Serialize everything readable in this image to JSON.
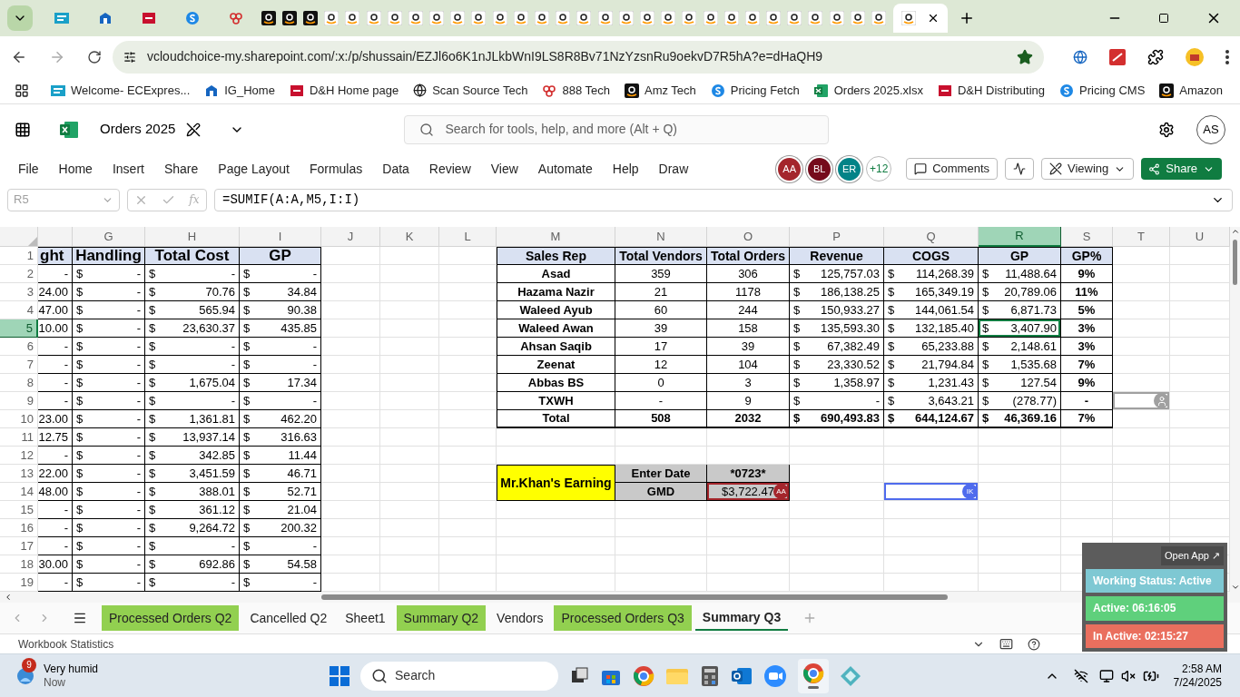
{
  "browser": {
    "tabs": [
      {
        "kind": "ec",
        "selected": false
      },
      {
        "kind": "ig",
        "selected": false
      },
      {
        "kind": "dh",
        "selected": false
      },
      {
        "kind": "s",
        "selected": false
      },
      {
        "kind": "rings",
        "selected": false
      },
      {
        "kind": "amazon_dark",
        "selected": false
      },
      {
        "kind": "amazon_dark",
        "selected": false
      },
      {
        "kind": "amazon_dark",
        "selected": false
      },
      {
        "kind": "amazon",
        "selected": false
      },
      {
        "kind": "amazon",
        "selected": false
      },
      {
        "kind": "amazon",
        "selected": false
      },
      {
        "kind": "amazon",
        "selected": false
      },
      {
        "kind": "amazon",
        "selected": false
      },
      {
        "kind": "amazon",
        "selected": false
      },
      {
        "kind": "amazon",
        "selected": false
      },
      {
        "kind": "amazon",
        "selected": false
      },
      {
        "kind": "amazon",
        "selected": false
      },
      {
        "kind": "amazon",
        "selected": false
      },
      {
        "kind": "amazon",
        "selected": false
      },
      {
        "kind": "amazon",
        "selected": false
      },
      {
        "kind": "amazon",
        "selected": false
      },
      {
        "kind": "amazon",
        "selected": false
      },
      {
        "kind": "amazon",
        "selected": false
      },
      {
        "kind": "amazon",
        "selected": false
      },
      {
        "kind": "amazon",
        "selected": false
      },
      {
        "kind": "amazon",
        "selected": false
      },
      {
        "kind": "amazon",
        "selected": false
      },
      {
        "kind": "amazon",
        "selected": false
      },
      {
        "kind": "amazon",
        "selected": false
      },
      {
        "kind": "amazon",
        "selected": false
      },
      {
        "kind": "amazon",
        "selected": false
      },
      {
        "kind": "amazon",
        "selected": false
      },
      {
        "kind": "amazon",
        "selected": false
      },
      {
        "kind": "amazon",
        "selected": false
      },
      {
        "kind": "amazon",
        "selected": false
      },
      {
        "kind": "amazon",
        "selected": true
      }
    ],
    "url": "vcloudchoice-my.sharepoint.com/:x:/p/shussain/EZJl6o6K1nJLkbWnI9LS8R8Bv71NzYzsnRu9oekvD7R5hA?e=dHaQH9",
    "bookmarks": [
      {
        "kind": "ec",
        "label": "Welcome- ECExpres..."
      },
      {
        "kind": "ig",
        "label": "IG_Home"
      },
      {
        "kind": "dh",
        "label": "D&H Home page"
      },
      {
        "kind": "globe",
        "label": "Scan Source Tech"
      },
      {
        "kind": "rings",
        "label": "888 Tech"
      },
      {
        "kind": "amazon_dark",
        "label": "Amz Tech"
      },
      {
        "kind": "s",
        "label": "Pricing Fetch"
      },
      {
        "kind": "excel",
        "label": "Orders 2025.xlsx"
      },
      {
        "kind": "dh",
        "label": "D&H Distributing"
      },
      {
        "kind": "s",
        "label": "Pricing CMS"
      },
      {
        "kind": "amazon_dark",
        "label": "Amazon"
      }
    ]
  },
  "app": {
    "file_name": "Orders 2025",
    "search_placeholder": "Search for tools, help, and more (Alt + Q)",
    "account_initials": "AS",
    "menu": [
      "File",
      "Home",
      "Insert",
      "Share",
      "Page Layout",
      "Formulas",
      "Data",
      "Review",
      "View",
      "Automate",
      "Help",
      "Draw"
    ],
    "collaborators": [
      {
        "initials": "AA",
        "color": "#a4262c"
      },
      {
        "initials": "BL",
        "color": "#750b1c"
      },
      {
        "initials": "ER",
        "color": "#038387"
      }
    ],
    "more_collaborators": "+12",
    "comments_label": "Comments",
    "mode_label": "Viewing",
    "share_label": "Share"
  },
  "formula_bar": {
    "name_box": "R5",
    "function_button": "fx",
    "formula": "=SUMIF(A:A,M5,I:I)"
  },
  "column_headers": [
    "G",
    "H",
    "I",
    "J",
    "K",
    "L",
    "M",
    "N",
    "O",
    "P",
    "Q",
    "R",
    "S",
    "T",
    "U"
  ],
  "row_numbers": [
    "1",
    "2",
    "3",
    "4",
    "5",
    "6",
    "7",
    "8",
    "9",
    "10",
    "11",
    "12",
    "13",
    "14",
    "15",
    "16",
    "17",
    "18",
    "19"
  ],
  "left_table": {
    "header": [
      "ght",
      "Handling",
      "Total Cost",
      "GP"
    ],
    "rows": [
      {
        "column_f": "-",
        "handling": {
          "symbol": "$",
          "value": "-"
        },
        "total_cost": {
          "symbol": "$",
          "value": "-"
        },
        "gp": {
          "symbol": "$",
          "value": "-"
        }
      },
      {
        "column_f": "24.00",
        "handling": {
          "symbol": "$",
          "value": "-"
        },
        "total_cost": {
          "symbol": "$",
          "value": "70.76"
        },
        "gp": {
          "symbol": "$",
          "value": "34.84"
        }
      },
      {
        "column_f": "47.00",
        "handling": {
          "symbol": "$",
          "value": "-"
        },
        "total_cost": {
          "symbol": "$",
          "value": "565.94"
        },
        "gp": {
          "symbol": "$",
          "value": "90.38"
        }
      },
      {
        "column_f": "10.00",
        "handling": {
          "symbol": "$",
          "value": "-"
        },
        "total_cost": {
          "symbol": "$",
          "value": "23,630.37"
        },
        "gp": {
          "symbol": "$",
          "value": "435.85"
        }
      },
      {
        "column_f": "-",
        "handling": {
          "symbol": "$",
          "value": "-"
        },
        "total_cost": {
          "symbol": "$",
          "value": "-"
        },
        "gp": {
          "symbol": "$",
          "value": "-"
        }
      },
      {
        "column_f": "-",
        "handling": {
          "symbol": "$",
          "value": "-"
        },
        "total_cost": {
          "symbol": "$",
          "value": "-"
        },
        "gp": {
          "symbol": "$",
          "value": "-"
        }
      },
      {
        "column_f": "-",
        "handling": {
          "symbol": "$",
          "value": "-"
        },
        "total_cost": {
          "symbol": "$",
          "value": "1,675.04"
        },
        "gp": {
          "symbol": "$",
          "value": "17.34"
        }
      },
      {
        "column_f": "-",
        "handling": {
          "symbol": "$",
          "value": "-"
        },
        "total_cost": {
          "symbol": "$",
          "value": "-"
        },
        "gp": {
          "symbol": "$",
          "value": "-"
        }
      },
      {
        "column_f": "23.00",
        "handling": {
          "symbol": "$",
          "value": "-"
        },
        "total_cost": {
          "symbol": "$",
          "value": "1,361.81"
        },
        "gp": {
          "symbol": "$",
          "value": "462.20"
        }
      },
      {
        "column_f": "12.75",
        "handling": {
          "symbol": "$",
          "value": "-"
        },
        "total_cost": {
          "symbol": "$",
          "value": "13,937.14"
        },
        "gp": {
          "symbol": "$",
          "value": "316.63"
        }
      },
      {
        "column_f": "-",
        "handling": {
          "symbol": "$",
          "value": "-"
        },
        "total_cost": {
          "symbol": "$",
          "value": "342.85"
        },
        "gp": {
          "symbol": "$",
          "value": "11.44"
        }
      },
      {
        "column_f": "22.00",
        "handling": {
          "symbol": "$",
          "value": "-"
        },
        "total_cost": {
          "symbol": "$",
          "value": "3,451.59"
        },
        "gp": {
          "symbol": "$",
          "value": "46.71"
        }
      },
      {
        "column_f": "48.00",
        "handling": {
          "symbol": "$",
          "value": "-"
        },
        "total_cost": {
          "symbol": "$",
          "value": "388.01"
        },
        "gp": {
          "symbol": "$",
          "value": "52.71"
        }
      },
      {
        "column_f": "-",
        "handling": {
          "symbol": "$",
          "value": "-"
        },
        "total_cost": {
          "symbol": "$",
          "value": "361.12"
        },
        "gp": {
          "symbol": "$",
          "value": "21.04"
        }
      },
      {
        "column_f": "-",
        "handling": {
          "symbol": "$",
          "value": "-"
        },
        "total_cost": {
          "symbol": "$",
          "value": "9,264.72"
        },
        "gp": {
          "symbol": "$",
          "value": "200.32"
        }
      },
      {
        "column_f": "-",
        "handling": {
          "symbol": "$",
          "value": "-"
        },
        "total_cost": {
          "symbol": "$",
          "value": "-"
        },
        "gp": {
          "symbol": "$",
          "value": "-"
        }
      },
      {
        "column_f": "30.00",
        "handling": {
          "symbol": "$",
          "value": "-"
        },
        "total_cost": {
          "symbol": "$",
          "value": "692.86"
        },
        "gp": {
          "symbol": "$",
          "value": "54.58"
        }
      },
      {
        "column_f": "-",
        "handling": {
          "symbol": "$",
          "value": "-"
        },
        "total_cost": {
          "symbol": "$",
          "value": "-"
        },
        "gp": {
          "symbol": "$",
          "value": "-"
        }
      }
    ]
  },
  "right_table": {
    "header": [
      "Sales Rep",
      "Total Vendors",
      "Total Orders",
      "Revenue",
      "COGS",
      "GP",
      "GP%"
    ],
    "rows": [
      {
        "kind": "rep",
        "sales_rep": "Asad",
        "total_vendors": "359",
        "total_orders": "306",
        "revenue": {
          "symbol": "$",
          "value": "125,757.03"
        },
        "cogs": {
          "symbol": "$",
          "value": "114,268.39"
        },
        "gp": {
          "symbol": "$",
          "value": "11,488.64",
          "selected": false
        },
        "gp_pct": "9%"
      },
      {
        "kind": "rep",
        "sales_rep": "Hazama Nazir",
        "total_vendors": "21",
        "total_orders": "1178",
        "revenue": {
          "symbol": "$",
          "value": "186,138.25"
        },
        "cogs": {
          "symbol": "$",
          "value": "165,349.19"
        },
        "gp": {
          "symbol": "$",
          "value": "20,789.06",
          "selected": false
        },
        "gp_pct": "11%"
      },
      {
        "kind": "rep",
        "sales_rep": "Waleed Ayub",
        "total_vendors": "60",
        "total_orders": "244",
        "revenue": {
          "symbol": "$",
          "value": "150,933.27"
        },
        "cogs": {
          "symbol": "$",
          "value": "144,061.54"
        },
        "gp": {
          "symbol": "$",
          "value": "6,871.73",
          "selected": false
        },
        "gp_pct": "5%"
      },
      {
        "kind": "rep",
        "sales_rep": "Waleed Awan",
        "total_vendors": "39",
        "total_orders": "158",
        "revenue": {
          "symbol": "$",
          "value": "135,593.30"
        },
        "cogs": {
          "symbol": "$",
          "value": "132,185.40"
        },
        "gp": {
          "symbol": "$",
          "value": "3,407.90",
          "selected": true
        },
        "gp_pct": "3%"
      },
      {
        "kind": "rep",
        "sales_rep": "Ahsan Saqib",
        "total_vendors": "17",
        "total_orders": "39",
        "revenue": {
          "symbol": "$",
          "value": "67,382.49"
        },
        "cogs": {
          "symbol": "$",
          "value": "65,233.88"
        },
        "gp": {
          "symbol": "$",
          "value": "2,148.61",
          "selected": false
        },
        "gp_pct": "3%"
      },
      {
        "kind": "rep",
        "sales_rep": "Zeenat",
        "total_vendors": "12",
        "total_orders": "104",
        "revenue": {
          "symbol": "$",
          "value": "23,330.52"
        },
        "cogs": {
          "symbol": "$",
          "value": "21,794.84"
        },
        "gp": {
          "symbol": "$",
          "value": "1,535.68",
          "selected": false
        },
        "gp_pct": "7%"
      },
      {
        "kind": "rep",
        "sales_rep": "Abbas BS",
        "total_vendors": "0",
        "total_orders": "3",
        "revenue": {
          "symbol": "$",
          "value": "1,358.97"
        },
        "cogs": {
          "symbol": "$",
          "value": "1,231.43"
        },
        "gp": {
          "symbol": "$",
          "value": "127.54",
          "selected": false
        },
        "gp_pct": "9%"
      },
      {
        "kind": "rep",
        "sales_rep": "TXWH",
        "total_vendors": "-",
        "total_orders": "9",
        "revenue": {
          "symbol": "$",
          "value": "-"
        },
        "cogs": {
          "symbol": "$",
          "value": "3,643.21"
        },
        "gp": {
          "symbol": "$",
          "value": "(278.77)",
          "selected": false
        },
        "gp_pct": "-"
      },
      {
        "kind": "total",
        "sales_rep": "Total",
        "total_vendors": "508",
        "total_orders": "2032",
        "revenue": {
          "symbol": "$",
          "value": "690,493.83"
        },
        "cogs": {
          "symbol": "$",
          "value": "644,124.67"
        },
        "gp": {
          "symbol": "$",
          "value": "46,369.16",
          "selected": false
        },
        "gp_pct": "7%"
      }
    ]
  },
  "earning": {
    "label": "Mr.Khan's Earning",
    "date_label": "Enter Date",
    "date_value": "*0723*",
    "gmd_label": "GMD",
    "gmd_value": "$3,722.47"
  },
  "presence": [
    {
      "kind": "user",
      "initials": "AA",
      "color": "#a4262c"
    },
    {
      "kind": "user",
      "initials": "IK",
      "color": "#4f6bed"
    },
    {
      "kind": "anonymous",
      "color": "#a0a0a0"
    }
  ],
  "sheet_tabs": [
    {
      "label": "Processed Orders Q2",
      "color": "#92d050",
      "selected": false
    },
    {
      "label": "Cancelled Q2",
      "selected": false
    },
    {
      "label": "Sheet1",
      "selected": false
    },
    {
      "label": "Summary Q2",
      "color": "#92d050",
      "selected": false
    },
    {
      "label": "Vendors",
      "selected": false
    },
    {
      "label": "Processed Orders Q3",
      "color": "#92d050",
      "selected": false
    },
    {
      "label": "Summary Q3",
      "selected": true
    }
  ],
  "status_bar": {
    "text": "Workbook Statistics"
  },
  "tracker": {
    "open_label": "Open App ↗",
    "items": [
      {
        "kind": "status",
        "text": "Working Status: Active"
      },
      {
        "kind": "active",
        "text": "Active: 06:16:05"
      },
      {
        "kind": "inactive",
        "text": "In Active: 02:15:27"
      }
    ]
  },
  "taskbar": {
    "weather_badge": "9",
    "weather_title": "Very humid",
    "weather_sub": "Now",
    "search_placeholder": "Search",
    "time": "2:58 AM",
    "date": "7/24/2025"
  }
}
